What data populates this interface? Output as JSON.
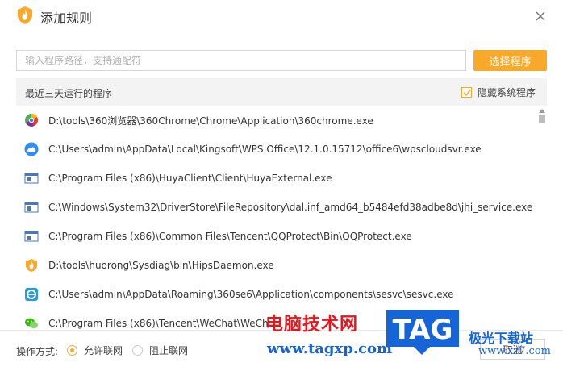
{
  "window": {
    "title": "添加规则"
  },
  "search": {
    "placeholder": "输入程序路径，支持通配符",
    "value": ""
  },
  "select_button": {
    "label": "选择程序"
  },
  "list_header": {
    "title": "最近三天运行的程序",
    "hide_system_label": "隐藏系统程序",
    "hide_system_checked": true
  },
  "programs": [
    {
      "icon": "chrome-360-icon",
      "path": "D:\\tools\\360浏览器\\360Chrome\\Chrome\\Application\\360chrome.exe"
    },
    {
      "icon": "wps-cloud-icon",
      "path": "C:\\Users\\admin\\AppData\\Local\\Kingsoft\\WPS Office\\12.1.0.15712\\office6\\wpscloudsvr.exe"
    },
    {
      "icon": "generic-exe-icon",
      "path": "C:\\Program Files (x86)\\HuyaClient\\Client\\HuyaExternal.exe"
    },
    {
      "icon": "generic-exe-icon",
      "path": "C:\\Windows\\System32\\DriverStore\\FileRepository\\dal.inf_amd64_b5484efd38adbe8d\\jhi_service.exe"
    },
    {
      "icon": "generic-exe-icon",
      "path": "C:\\Program Files (x86)\\Common Files\\Tencent\\QQProtect\\Bin\\QQProtect.exe"
    },
    {
      "icon": "huorong-icon",
      "path": "D:\\tools\\huorong\\Sysdiag\\bin\\HipsDaemon.exe"
    },
    {
      "icon": "browser-360se-icon",
      "path": "C:\\Users\\admin\\AppData\\Roaming\\360se6\\Application\\components\\sesvc\\sesvc.exe"
    },
    {
      "icon": "wechat-icon",
      "path": "C:\\Program Files (x86)\\Tencent\\WeChat\\WeCh"
    }
  ],
  "footer": {
    "operation_label": "操作方式:",
    "allow_label": "允许联网",
    "block_label": "阻止联网",
    "selected": "allow",
    "cancel_label": "取消"
  },
  "watermark": {
    "site_name": "电脑技术网",
    "url": "www.tagxp.com",
    "logo_text": "TAG",
    "right_line1": "极光下载站",
    "right_line2": "www.xz7.com"
  },
  "colors": {
    "accent": "#f8a92c",
    "watermark_red": "#e5161e",
    "watermark_blue": "#1565d8"
  }
}
